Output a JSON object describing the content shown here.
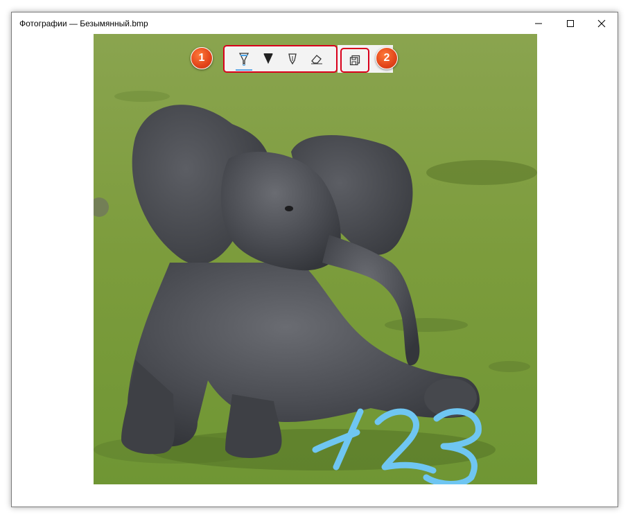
{
  "window": {
    "title": "Фотографии — Безымянный.bmp"
  },
  "caption_buttons": {
    "minimize": "minimize-icon",
    "maximize": "maximize-icon",
    "close": "close-icon"
  },
  "ink_toolbar": {
    "tools": [
      {
        "name": "ballpoint-pen",
        "icon": "ballpoint-pen-icon",
        "active": true
      },
      {
        "name": "pencil",
        "icon": "pencil-icon",
        "active": false
      },
      {
        "name": "calligraphy-pen",
        "icon": "calligraphy-pen-icon",
        "active": false
      },
      {
        "name": "eraser",
        "icon": "eraser-icon",
        "active": false
      }
    ],
    "save_icon": "save-copy-icon"
  },
  "annotations": {
    "badge_1": "1",
    "badge_2": "2"
  },
  "drawing": {
    "handwritten_text": "123",
    "ink_color": "#6fc6f2"
  },
  "colors": {
    "highlight_border": "#d9001b",
    "badge_color": "#e2441a"
  }
}
